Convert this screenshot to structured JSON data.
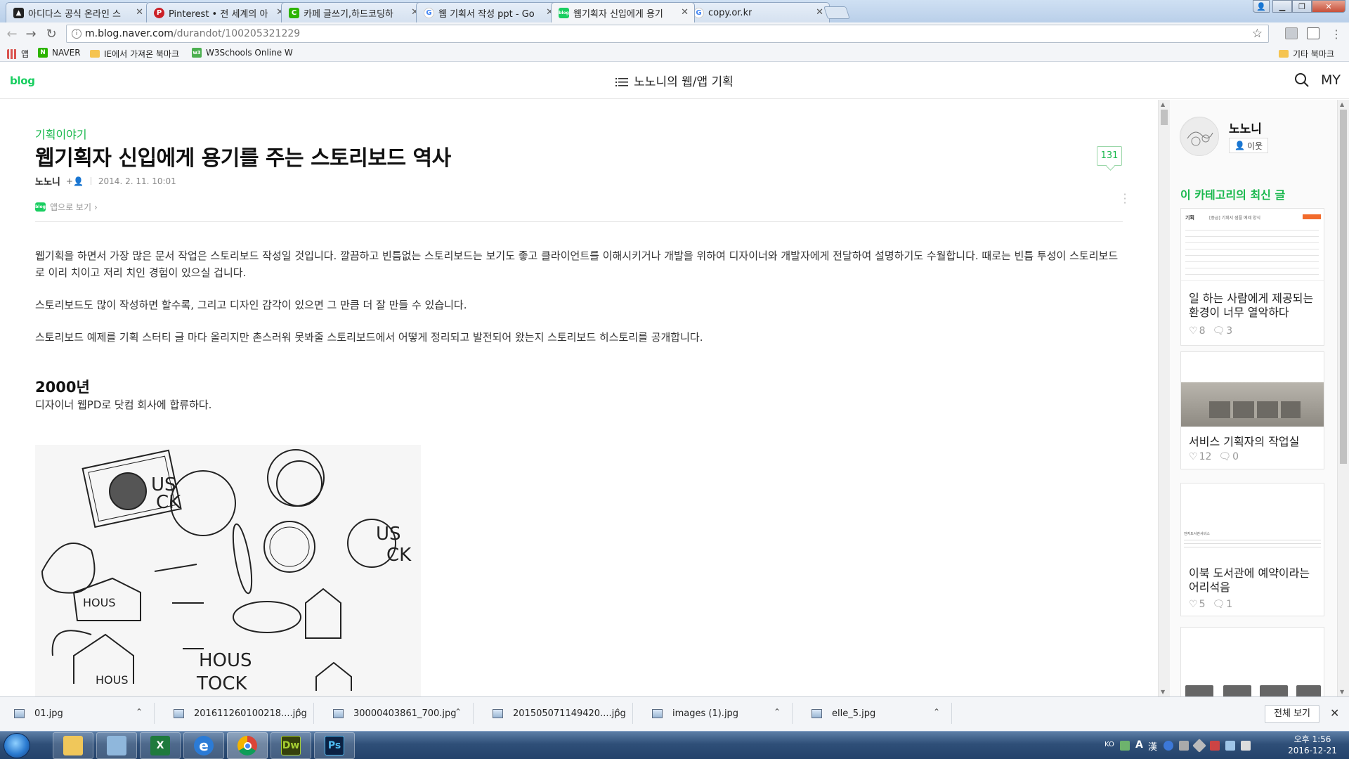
{
  "browser": {
    "tabs": [
      {
        "title": "아디다스 공식 온라인 스",
        "favicon": "adidas-icon",
        "color": "#222222"
      },
      {
        "title": "Pinterest • 전 세계의 아",
        "favicon": "pinterest-icon",
        "color": "#cb2027"
      },
      {
        "title": "카페 글쓰기,하드코딩하",
        "favicon": "naver-cafe-icon",
        "color": "#2db400"
      },
      {
        "title": "웹 기획서 작성 ppt - Go",
        "favicon": "google-icon",
        "color": "#4285f4"
      },
      {
        "title": "웹기획자 신입에게 용기",
        "favicon": "naver-blog-icon",
        "color": "#19ce60"
      },
      {
        "title": "copy.or.kr",
        "favicon": "google-icon",
        "color": "#4285f4"
      }
    ],
    "url_host": "m.blog.naver.com",
    "url_path": "/durandot/100205321229",
    "bookmarks": [
      {
        "label": "앱"
      },
      {
        "label": "NAVER"
      },
      {
        "label": "IE에서 가져온 북마크"
      },
      {
        "label": "W3Schools Online W"
      }
    ],
    "other_bookmarks": "기타 북마크"
  },
  "blog": {
    "logo": "blog",
    "title": "노노니의 웹/앱 기획",
    "my": "MY",
    "accent": "#19ce60"
  },
  "post": {
    "category": "기획이야기",
    "title": "웹기획자 신입에게 용기를 주는 스토리보드 역사",
    "comment_count": "131",
    "author": "노노니",
    "follow": "+",
    "date": "2014. 2. 11. 10:01",
    "app_view": "앱으로 보기",
    "paragraphs": [
      "웹기획을 하면서 가장 많은 문서 작업은 스토리보드 작성일 것입니다. 깔끔하고 빈틈없는 스토리보드는 보기도 좋고 클라이언트를 이해시키거나 개발을 위하여 디자이너와 개발자에게 전달하여 설명하기도 수월합니다. 때로는 빈틈 투성이 스토리보드로 이리 치이고 저리 치인 경험이 있으실 겁니다.",
      "스토리보드도 많이 작성하면 할수록, 그리고 디자인 감각이 있으면 그 만큼 더 잘 만들 수 있습니다.",
      "스토리보드 예제를 기획 스터티 글 마다 올리지만 촌스러워 못봐줄 스토리보드에서 어떻게 정리되고 발전되어 왔는지 스토리보드 히스토리를 공개합니다."
    ],
    "year_heading": "2000년",
    "year_desc": "디자이너 웹PD로 닷컴 회사에 합류하다.",
    "sketch_words": [
      "US",
      "CK",
      "HOUS",
      "TOCK"
    ]
  },
  "sidebar": {
    "profile_name": "노노니",
    "neighbor": "이웃",
    "latest_title": "이 카테고리의 최신 글",
    "cards": [
      {
        "title": "일 하는 사람에게 제공되는 환경이 너무 열악하다",
        "likes": "8",
        "comments": "3",
        "thumb_label": "기획",
        "thumb_header": "[중급] 기획서 샘플 예제 양식"
      },
      {
        "title": "서비스 기획자의 작업실",
        "likes": "12",
        "comments": "0"
      },
      {
        "title": "이북 도서관에 예약이라는 어리석음",
        "likes": "5",
        "comments": "1",
        "thumb_header": "전자도서관서비스"
      },
      {
        "title": "",
        "likes": "",
        "comments": ""
      }
    ]
  },
  "downloads": {
    "items": [
      "01.jpg",
      "201611260100218....jpg",
      "30000403861_700.jpg",
      "201505071149420....jpg",
      "images (1).jpg",
      "elle_5.jpg"
    ],
    "show_all": "전체 보기"
  },
  "taskbar": {
    "apps": [
      {
        "name": "explorer",
        "label": ""
      },
      {
        "name": "notepad",
        "label": ""
      },
      {
        "name": "excel",
        "label": "X"
      },
      {
        "name": "ie",
        "label": "e"
      },
      {
        "name": "chrome",
        "label": ""
      },
      {
        "name": "dreamweaver",
        "label": "Dw"
      },
      {
        "name": "photoshop",
        "label": "Ps"
      }
    ],
    "tray_lang": "KO",
    "tray_ime": "漢",
    "tray_a": "A",
    "time": "오후 1:56",
    "date": "2016-12-21"
  }
}
